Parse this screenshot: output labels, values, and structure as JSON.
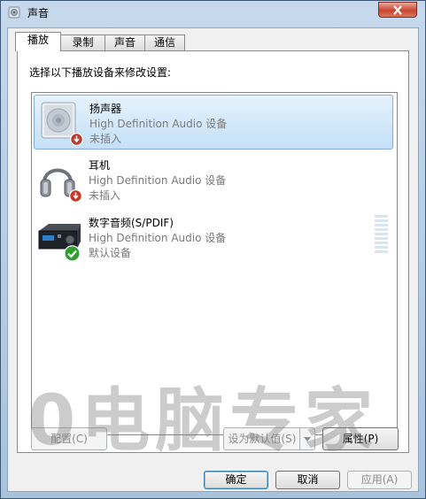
{
  "window": {
    "title": "声音"
  },
  "tabs": [
    {
      "label": "播放",
      "active": true
    },
    {
      "label": "录制",
      "active": false
    },
    {
      "label": "声音",
      "active": false
    },
    {
      "label": "通信",
      "active": false
    }
  ],
  "panel": {
    "instruction": "选择以下播放设备来修改设置:"
  },
  "devices": [
    {
      "name": "扬声器",
      "description": "High Definition Audio 设备",
      "status": "未插入",
      "icon": "speaker-icon",
      "badge": "unplugged-badge-icon"
    },
    {
      "name": "耳机",
      "description": "High Definition Audio 设备",
      "status": "未插入",
      "icon": "headphones-icon",
      "badge": "unplugged-badge-icon"
    },
    {
      "name": "数字音频(S/PDIF)",
      "description": "High Definition Audio 设备",
      "status": "默认设备",
      "icon": "digital-audio-receiver-icon",
      "badge": "default-device-check-icon"
    }
  ],
  "buttons": {
    "configure": "配置(C)",
    "set_default": "设为默认值(S)",
    "properties": "属性(P)",
    "ok": "确定",
    "cancel": "取消",
    "apply": "应用(A)"
  },
  "watermark": "0电脑专家",
  "colors": {
    "selection": "#c4e0f7",
    "unplugged_badge": "#c0392b",
    "default_badge": "#2e9e2e"
  }
}
